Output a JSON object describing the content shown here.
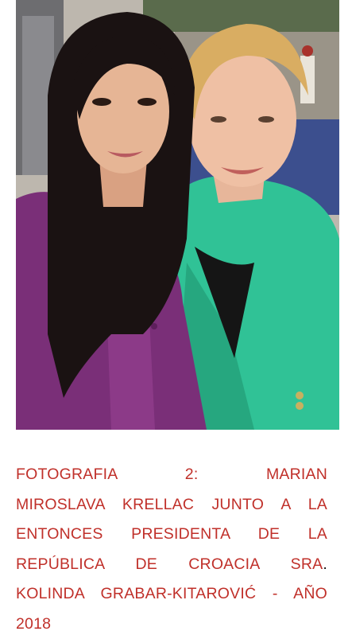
{
  "caption": {
    "line1": "FOTOGRAFIA 2: MARIAN",
    "line2": "MIROSLAVA KRELLAC JUNTO A LA",
    "line3": "ENTONCES PRESIDENTA DE LA",
    "line4a": "REPÚBLICA DE CROACIA SRA",
    "line4b": ".",
    "line5": "KOLINDA GRABAR-KITAROVIĆ - AÑO",
    "line6": "2018"
  },
  "colors": {
    "caption_text": "#c0302a",
    "period": "#111111",
    "left_dress": "#7a2f78",
    "right_jacket": "#2fbf8f"
  }
}
